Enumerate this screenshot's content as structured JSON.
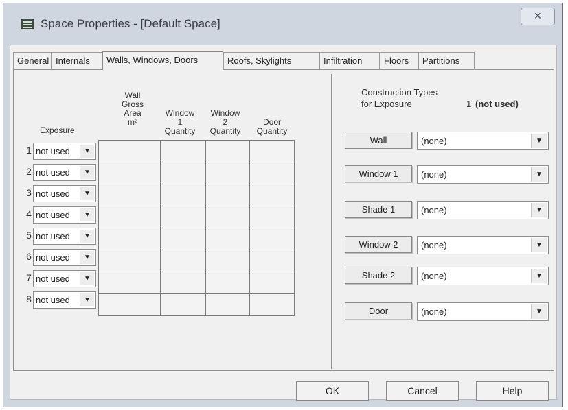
{
  "window": {
    "title": "Space Properties - [Default Space]",
    "close_label": "✕"
  },
  "tabs": [
    {
      "label": "General"
    },
    {
      "label": "Internals"
    },
    {
      "label": "Walls, Windows, Doors"
    },
    {
      "label": "Roofs, Skylights"
    },
    {
      "label": "Infiltration"
    },
    {
      "label": "Floors"
    },
    {
      "label": "Partitions"
    }
  ],
  "table": {
    "headers": {
      "exposure": "Exposure",
      "wall_area": [
        "Wall",
        "Gross",
        "Area",
        "m²"
      ],
      "window1": [
        "Window",
        "1",
        "Quantity"
      ],
      "window2": [
        "Window",
        "2",
        "Quantity"
      ],
      "door": [
        "Door",
        "Quantity"
      ]
    },
    "rows": [
      {
        "num": "1",
        "exposure": "not used"
      },
      {
        "num": "2",
        "exposure": "not used"
      },
      {
        "num": "3",
        "exposure": "not used"
      },
      {
        "num": "4",
        "exposure": "not used"
      },
      {
        "num": "5",
        "exposure": "not used"
      },
      {
        "num": "6",
        "exposure": "not used"
      },
      {
        "num": "7",
        "exposure": "not used"
      },
      {
        "num": "8",
        "exposure": "not used"
      }
    ]
  },
  "construction": {
    "heading": "Construction Types",
    "exposure_label": "for Exposure",
    "exposure_num": "1",
    "exposure_state": "(not used)",
    "items": [
      {
        "button": "Wall",
        "value": "(none)"
      },
      {
        "button": "Window 1",
        "value": "(none)"
      },
      {
        "button": "Shade 1",
        "value": "(none)"
      },
      {
        "button": "Window 2",
        "value": "(none)"
      },
      {
        "button": "Shade 2",
        "value": "(none)"
      },
      {
        "button": "Door",
        "value": "(none)"
      }
    ]
  },
  "footer": {
    "ok": "OK",
    "cancel": "Cancel",
    "help": "Help"
  },
  "icons": {
    "dropdown": "▼"
  }
}
